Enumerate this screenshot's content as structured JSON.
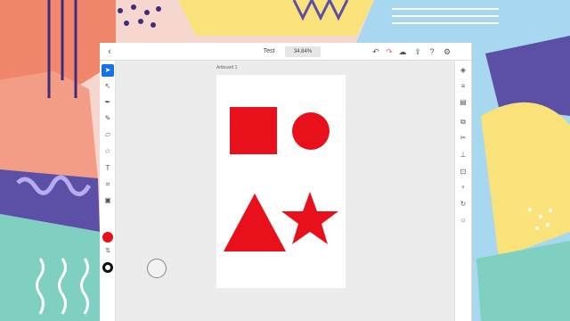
{
  "colors": {
    "accent": "#1473e6",
    "shape_fill": "#e8101a",
    "stroke": "#111111"
  },
  "header": {
    "back_icon": "chevron-left-icon",
    "title": "Test",
    "zoom": "34.84%",
    "actions": [
      "undo-icon",
      "redo-icon",
      "cloud-sync-icon",
      "share-icon",
      "help-icon",
      "settings-icon"
    ]
  },
  "left_tools": [
    "selection-tool-icon",
    "direct-selection-tool-icon",
    "pen-tool-icon",
    "pencil-tool-icon",
    "eraser-tool-icon",
    "shape-tool-icon",
    "text-tool-icon",
    "crop-tool-icon",
    "place-image-icon"
  ],
  "right_tools": [
    "layers-icon",
    "properties-icon",
    "libraries-icon",
    "arrange-icon",
    "scissors-icon",
    "align-icon",
    "export-icon",
    "type-settings-icon",
    "transform-icon",
    "brightness-icon"
  ],
  "artboard": {
    "label": "Artboard 1",
    "shapes": [
      "square",
      "circle",
      "triangle",
      "star"
    ]
  }
}
